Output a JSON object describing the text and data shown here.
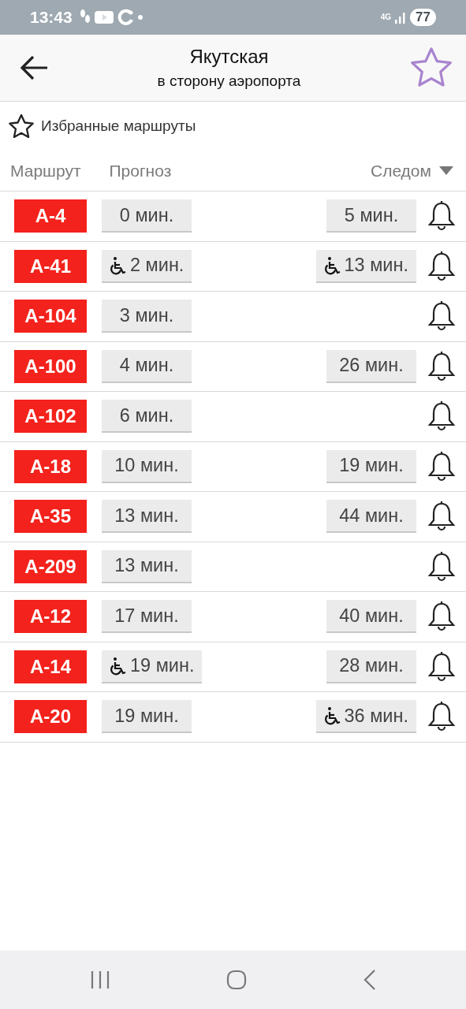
{
  "status_bar": {
    "time": "13:43",
    "network": "4G",
    "battery": "77"
  },
  "header": {
    "title": "Якутская",
    "subtitle": "в сторону аэропорта",
    "favorite": false
  },
  "favorites_link": {
    "label": "Избранные маршруты"
  },
  "columns": {
    "route": "Маршрут",
    "forecast": "Прогноз",
    "next": "Следом"
  },
  "rows": [
    {
      "route": "А-4",
      "forecast": {
        "time": "0 мин.",
        "accessible": false
      },
      "next": {
        "time": "5 мин.",
        "accessible": false
      }
    },
    {
      "route": "А-41",
      "forecast": {
        "time": "2 мин.",
        "accessible": true
      },
      "next": {
        "time": "13 мин.",
        "accessible": true
      }
    },
    {
      "route": "А-104",
      "forecast": {
        "time": "3 мин.",
        "accessible": false
      }
    },
    {
      "route": "А-100",
      "forecast": {
        "time": "4 мин.",
        "accessible": false
      },
      "next": {
        "time": "26 мин.",
        "accessible": false
      }
    },
    {
      "route": "А-102",
      "forecast": {
        "time": "6 мин.",
        "accessible": false
      }
    },
    {
      "route": "А-18",
      "forecast": {
        "time": "10 мин.",
        "accessible": false
      },
      "next": {
        "time": "19 мин.",
        "accessible": false
      }
    },
    {
      "route": "А-35",
      "forecast": {
        "time": "13 мин.",
        "accessible": false
      },
      "next": {
        "time": "44 мин.",
        "accessible": false
      }
    },
    {
      "route": "А-209",
      "forecast": {
        "time": "13 мин.",
        "accessible": false
      }
    },
    {
      "route": "А-12",
      "forecast": {
        "time": "17 мин.",
        "accessible": false
      },
      "next": {
        "time": "40 мин.",
        "accessible": false
      }
    },
    {
      "route": "А-14",
      "forecast": {
        "time": "19 мин.",
        "accessible": true
      },
      "next": {
        "time": "28 мин.",
        "accessible": false
      }
    },
    {
      "route": "А-20",
      "forecast": {
        "time": "19 мин.",
        "accessible": false
      },
      "next": {
        "time": "36 мин.",
        "accessible": true
      }
    }
  ]
}
